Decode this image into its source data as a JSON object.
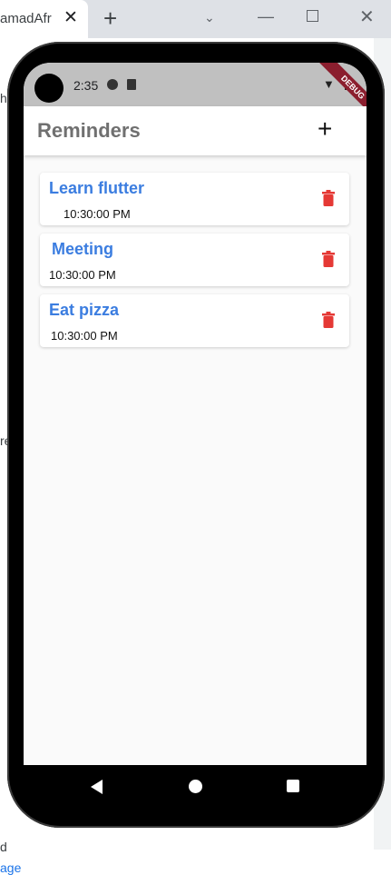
{
  "browser": {
    "tab_title": "amadAfr",
    "tab_close": "✕",
    "new_tab": "+",
    "edge_text": [
      "h",
      "re",
      "d",
      "age"
    ]
  },
  "status_bar": {
    "time": "2:35",
    "debug_banner": "DEBUG"
  },
  "app_bar": {
    "title": "Reminders",
    "add_icon": "+"
  },
  "reminders": [
    {
      "title": "Learn flutter",
      "time": "10:30:00 PM"
    },
    {
      "title": "Meeting",
      "time": "10:30:00 PM"
    },
    {
      "title": "Eat pizza",
      "time": "10:30:00 PM"
    }
  ],
  "colors": {
    "title_blue": "#3b7de0",
    "delete_red": "#e53935",
    "app_title_gray": "#707070"
  },
  "icons": {
    "delete": "trash-icon",
    "nav_back": "back-triangle-icon",
    "nav_home": "home-circle-icon",
    "nav_recent": "recent-square-icon"
  }
}
